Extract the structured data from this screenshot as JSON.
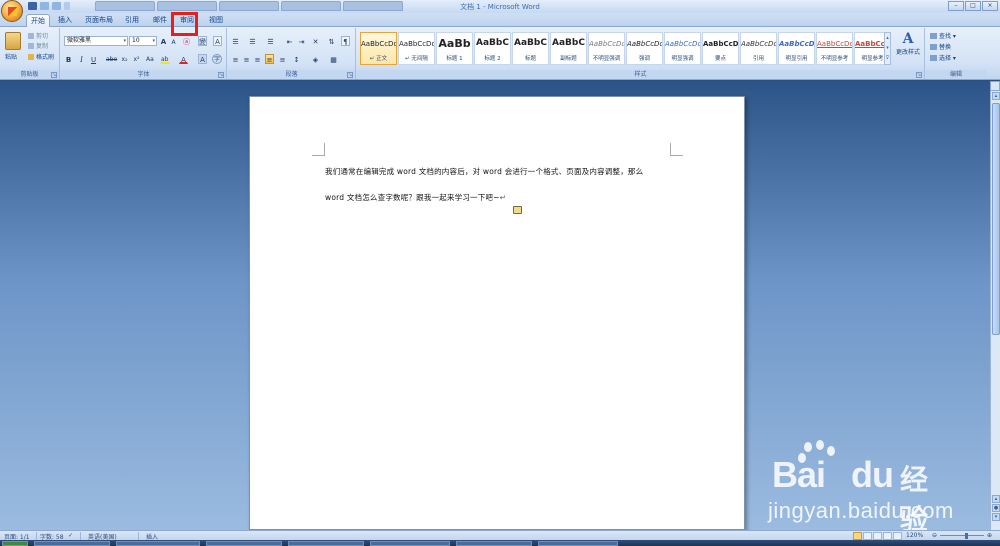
{
  "window": {
    "title": "文档 1 - Microsoft Word",
    "controls": [
      "–",
      "□",
      "×"
    ]
  },
  "tabs": [
    "开始",
    "插入",
    "页面布局",
    "引用",
    "邮件",
    "审阅",
    "视图"
  ],
  "active_tab": "开始",
  "highlighted_tab": "审阅",
  "clipboard": {
    "paste": "粘贴",
    "cut": "剪切",
    "copy": "复制",
    "format_painter": "格式刷",
    "label": "剪贴板"
  },
  "font": {
    "name": "微软雅黑",
    "size": "10",
    "grow": "A",
    "shrink": "A",
    "clear": "ⓐ",
    "pinyin": "變",
    "border_char": "A",
    "bold": "B",
    "italic": "I",
    "underline": "U",
    "strike": "abe",
    "sub": "x₂",
    "sup": "x²",
    "case": "Aa",
    "highlight": "ab",
    "color": "A",
    "shade": "A",
    "enclose": "字",
    "label": "字体"
  },
  "paragraph": {
    "label": "段落"
  },
  "styles": {
    "label": "样式",
    "items": [
      {
        "sample": "AaBbCcDd",
        "name": "↵ 正文"
      },
      {
        "sample": "AaBbCcDd",
        "name": "↵ 无间隔"
      },
      {
        "sample": "AaBb",
        "name": "标题 1"
      },
      {
        "sample": "AaBbC",
        "name": "标题 2"
      },
      {
        "sample": "AaBbC",
        "name": "标题"
      },
      {
        "sample": "AaBbC",
        "name": "副标题"
      },
      {
        "sample": "AaBbCcDd",
        "name": "不明显强调"
      },
      {
        "sample": "AaBbCcDd",
        "name": "强调"
      },
      {
        "sample": "AaBbCcDd",
        "name": "明显强调"
      },
      {
        "sample": "AaBbCcDd",
        "name": "要点"
      },
      {
        "sample": "AaBbCcDd",
        "name": "引用"
      },
      {
        "sample": "AaBbCcDd",
        "name": "明显引用"
      },
      {
        "sample": "AaBbCcDd",
        "name": "不明显参考"
      },
      {
        "sample": "AaBbCcDd",
        "name": "明显参考"
      }
    ],
    "change_styles": "更改样式"
  },
  "editing": {
    "label": "编辑",
    "find": "查找 ▾",
    "replace": "替换",
    "select": "选择 ▾"
  },
  "document": {
    "line1": "我们通常在编辑完成 word 文档的内容后，对 word 会进行一个格式、页面及内容调整，那么",
    "line2": "word 文档怎么查字数呢？跟我一起来学习一下吧~",
    "para_mark": "↵"
  },
  "status": {
    "page": "页面: 1/1",
    "words": "字数: 58",
    "language": "英语(美国)",
    "mode": "插入",
    "zoom": "120%"
  },
  "watermark": {
    "brand": "Bai",
    "brand2": "du",
    "cn": "经验",
    "url": "jingyan.baidu.com"
  }
}
